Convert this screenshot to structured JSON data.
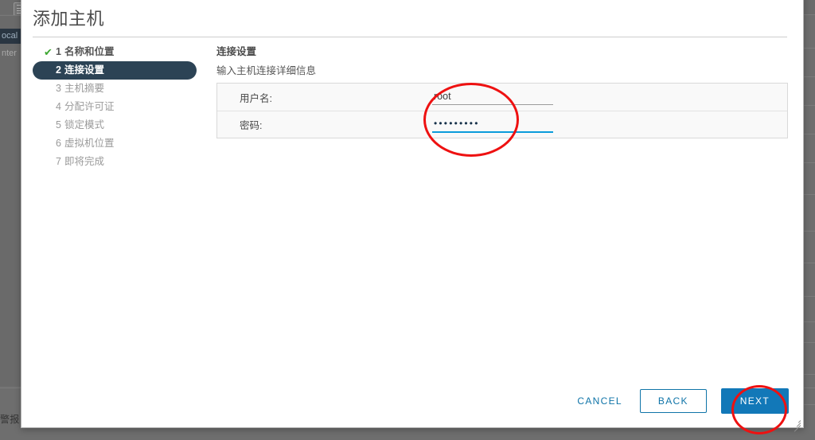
{
  "background_app": {
    "nav_icon": "list-icon",
    "tree_selected_item": "ocal",
    "tree_item": "nter",
    "alerts_label": "警报"
  },
  "dialog": {
    "title": "添加主机",
    "steps": [
      {
        "num": "1",
        "label": "名称和位置",
        "state": "done",
        "check": "✔"
      },
      {
        "num": "2",
        "label": "连接设置",
        "state": "active"
      },
      {
        "num": "3",
        "label": "主机摘要",
        "state": "pending"
      },
      {
        "num": "4",
        "label": "分配许可证",
        "state": "pending"
      },
      {
        "num": "5",
        "label": "锁定模式",
        "state": "pending"
      },
      {
        "num": "6",
        "label": "虚拟机位置",
        "state": "pending"
      },
      {
        "num": "7",
        "label": "即将完成",
        "state": "pending"
      }
    ],
    "pane": {
      "heading": "连接设置",
      "subheading": "输入主机连接详细信息"
    },
    "form": {
      "username": {
        "label": "用户名:",
        "value": "root",
        "placeholder": ""
      },
      "password": {
        "label": "密码:",
        "value": "•••••••••",
        "placeholder": ""
      }
    },
    "footer": {
      "cancel_label": "CANCEL",
      "back_label": "BACK",
      "next_label": "NEXT"
    }
  },
  "colors": {
    "accent_blue": "#1278b8",
    "link_blue": "#0f74a8",
    "focus_underline": "#0a9bdb",
    "active_step_bg": "#2c4355",
    "check_green": "#3ea832",
    "annotation_red": "#ee1111",
    "dim_backdrop": "#6e6e6e"
  },
  "annotations": [
    {
      "name": "credentials-highlight",
      "shape": "ellipse"
    },
    {
      "name": "next-button-highlight",
      "shape": "ellipse"
    }
  ]
}
